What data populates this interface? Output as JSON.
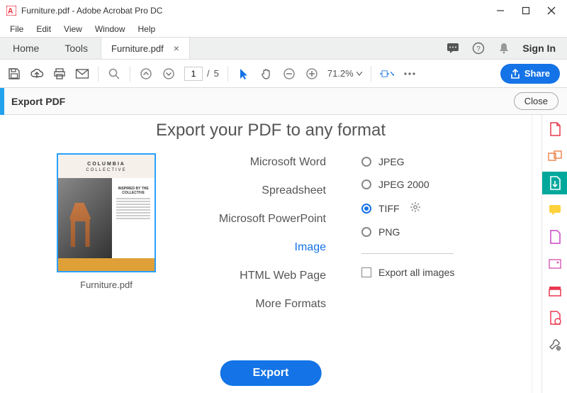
{
  "titlebar": {
    "title": "Furniture.pdf - Adobe Acrobat Pro DC"
  },
  "menu": {
    "file": "File",
    "edit": "Edit",
    "view": "View",
    "window": "Window",
    "help": "Help"
  },
  "tabs": {
    "home": "Home",
    "tools": "Tools",
    "doc": "Furniture.pdf",
    "signin": "Sign In"
  },
  "toolbar": {
    "page_current": "1",
    "page_sep": "/",
    "page_total": "5",
    "zoom": "71.2%",
    "share": "Share"
  },
  "panel": {
    "title": "Export PDF",
    "close": "Close"
  },
  "heading": "Export your PDF to any format",
  "thumb": {
    "title": "COLUMBIA",
    "subtitle": "COLLECTIVE",
    "side_heading": "INSPIRED BY THE COLLECTIVE",
    "filename": "Furniture.pdf"
  },
  "formats": {
    "word": "Microsoft Word",
    "spreadsheet": "Spreadsheet",
    "ppt": "Microsoft PowerPoint",
    "image": "Image",
    "html": "HTML Web Page",
    "more": "More Formats"
  },
  "options": {
    "jpeg": "JPEG",
    "jpeg2000": "JPEG 2000",
    "tiff": "TIFF",
    "png": "PNG",
    "export_all": "Export all images"
  },
  "action": {
    "export": "Export"
  }
}
